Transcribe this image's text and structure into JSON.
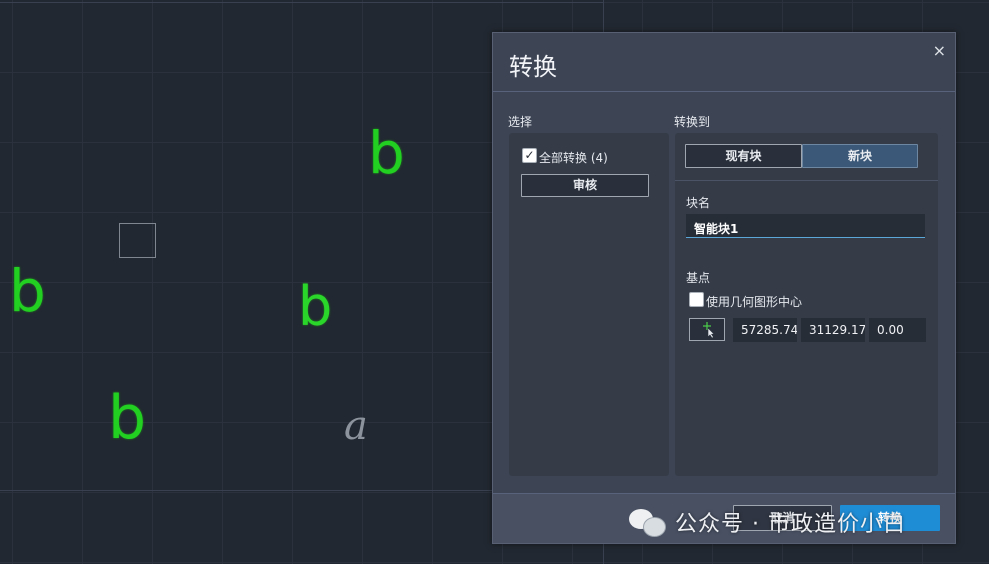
{
  "canvas": {
    "glyphs": [
      "b",
      "b",
      "b",
      "b",
      "a"
    ]
  },
  "dialog": {
    "title": "转换",
    "close_icon": "×",
    "select": {
      "label": "选择",
      "convert_all_label": "全部转换 (4)",
      "convert_all_checked": true,
      "review_button": "审核"
    },
    "convert_to": {
      "label": "转换到",
      "existing_block": "现有块",
      "new_block": "新块",
      "active": "new_block",
      "block_name_label": "块名",
      "block_name_value": "智能块1",
      "base_point_label": "基点",
      "use_geometry_center_label": "使用几何图形中心",
      "use_geometry_center_checked": false,
      "x": "57285.74",
      "y": "31129.17",
      "z": "0.00"
    },
    "footer": {
      "cancel_button": "取消",
      "convert_button": "转换"
    }
  },
  "watermark": {
    "text": "公众号 · 市政造价小白"
  },
  "colors": {
    "accent": "#1f8dd6",
    "glyph_green": "#22d022"
  }
}
